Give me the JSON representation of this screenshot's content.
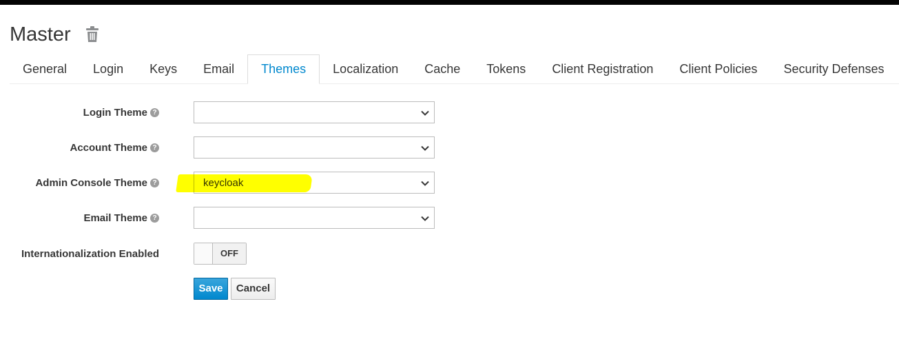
{
  "realm": {
    "title": "Master",
    "delete_icon": "trash-icon"
  },
  "tabs": [
    {
      "label": "General",
      "active": false
    },
    {
      "label": "Login",
      "active": false
    },
    {
      "label": "Keys",
      "active": false
    },
    {
      "label": "Email",
      "active": false
    },
    {
      "label": "Themes",
      "active": true
    },
    {
      "label": "Localization",
      "active": false
    },
    {
      "label": "Cache",
      "active": false
    },
    {
      "label": "Tokens",
      "active": false
    },
    {
      "label": "Client Registration",
      "active": false
    },
    {
      "label": "Client Policies",
      "active": false
    },
    {
      "label": "Security Defenses",
      "active": false
    }
  ],
  "form": {
    "login_theme": {
      "label": "Login Theme",
      "value": ""
    },
    "account_theme": {
      "label": "Account Theme",
      "value": ""
    },
    "admin_console_theme": {
      "label": "Admin Console Theme",
      "value": "keycloak"
    },
    "email_theme": {
      "label": "Email Theme",
      "value": ""
    },
    "internationalization": {
      "label": "Internationalization Enabled",
      "state": "OFF"
    },
    "help_icon": "question-circle-icon"
  },
  "buttons": {
    "save": "Save",
    "cancel": "Cancel"
  },
  "colors": {
    "accent": "#0088ce",
    "highlight": "#ffff00",
    "topbar": "#030303"
  }
}
